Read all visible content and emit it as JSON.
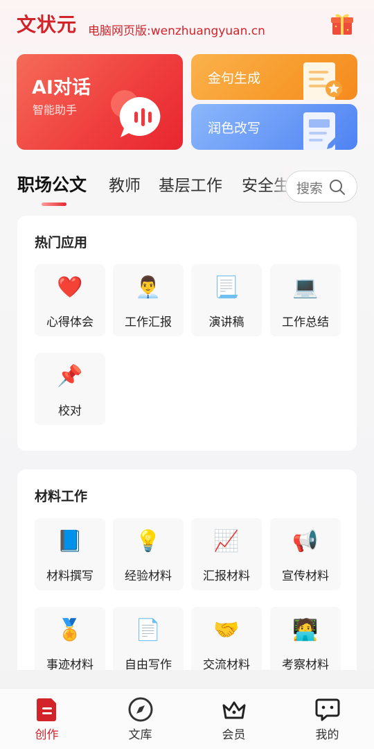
{
  "header": {
    "logo": "文状元",
    "subtitle": "电脑网页版:wenzhuangyuan.cn",
    "gift_icon": "gift-icon"
  },
  "features": {
    "ai_chat": {
      "title": "AI对话",
      "subtitle": "智能助手",
      "icon": "chat-bubble-icon"
    },
    "golden_sentence": {
      "title": "金句生成",
      "icon": "document-star-icon"
    },
    "polish": {
      "title": "润色改写",
      "icon": "document-pen-icon"
    }
  },
  "tabs": [
    {
      "label": "职场公文",
      "active": true
    },
    {
      "label": "教师",
      "active": false
    },
    {
      "label": "基层工作",
      "active": false
    },
    {
      "label": "安全生",
      "active": false
    }
  ],
  "search": {
    "label": "搜索",
    "icon": "search-icon"
  },
  "sections": [
    {
      "title": "热门应用",
      "items": [
        {
          "label": "心得体会",
          "icon": "❤️"
        },
        {
          "label": "工作汇报",
          "icon": "👨‍💼"
        },
        {
          "label": "演讲稿",
          "icon": "📃"
        },
        {
          "label": "工作总结",
          "icon": "💻"
        },
        {
          "label": "校对",
          "icon": "📌"
        }
      ]
    },
    {
      "title": "材料工作",
      "items": [
        {
          "label": "材料撰写",
          "icon": "📘"
        },
        {
          "label": "经验材料",
          "icon": "💡"
        },
        {
          "label": "汇报材料",
          "icon": "📈"
        },
        {
          "label": "宣传材料",
          "icon": "📢"
        },
        {
          "label": "事迹材料",
          "icon": "🏅"
        },
        {
          "label": "自由写作",
          "icon": "📄"
        },
        {
          "label": "交流材料",
          "icon": "🤝"
        },
        {
          "label": "考察材料",
          "icon": "🧑‍💻"
        }
      ]
    }
  ],
  "bottom_nav": [
    {
      "label": "创作",
      "icon": "create-doc-icon",
      "active": true
    },
    {
      "label": "文库",
      "icon": "compass-icon",
      "active": false
    },
    {
      "label": "会员",
      "icon": "crown-icon",
      "active": false
    },
    {
      "label": "我的",
      "icon": "message-face-icon",
      "active": false
    }
  ],
  "colors": {
    "brand_red": "#d2232a",
    "ai_card": "#ef3d3d",
    "gold_card": "#f79a2b",
    "blue_card": "#6697f6"
  }
}
